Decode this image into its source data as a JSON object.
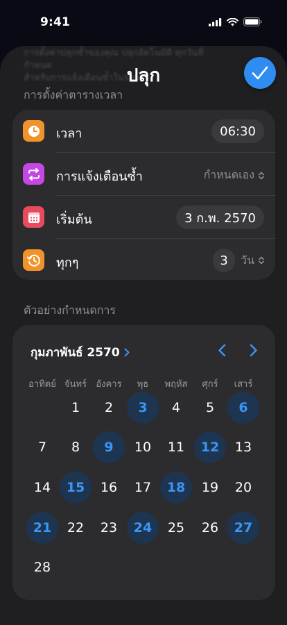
{
  "status": {
    "time": "9:41"
  },
  "behind_text": [
    "การตั้งค่าปลุกซ้ำของคุณ ปลุกอัตโนมัติ ทุกวันที่กำหนด",
    "สำหรับการแจ้งเตือนซ้ำในรอบ"
  ],
  "title": "ปลุก",
  "section_schedule": "การตั้งค่าตารางเวลา",
  "rows": {
    "time": {
      "label": "เวลา",
      "value": "06:30"
    },
    "repeat": {
      "label": "การแจ้งเตือนซ้ำ",
      "value": "กำหนดเอง"
    },
    "start": {
      "label": "เริ่มต้น",
      "value": "3 ก.พ. 2570"
    },
    "every": {
      "label": "ทุกๆ",
      "value": "3",
      "unit": "วัน"
    }
  },
  "section_example": "ตัวอย่างกำหนดการ",
  "calendar": {
    "month": "กุมภาพันธ์ 2570",
    "weekdays": [
      "อาทิตย์",
      "จันทร์",
      "อังคาร",
      "พุธ",
      "พฤหัส",
      "ศุกร์",
      "เสาร์"
    ],
    "first_weekday_index": 1,
    "days_in_month": 28,
    "highlighted": [
      3,
      6,
      9,
      12,
      15,
      18,
      21,
      24,
      27
    ]
  },
  "colors": {
    "accent": "#2f8cf0",
    "highlight_bg": "#1d3550",
    "highlight_text": "#3a97f5"
  }
}
